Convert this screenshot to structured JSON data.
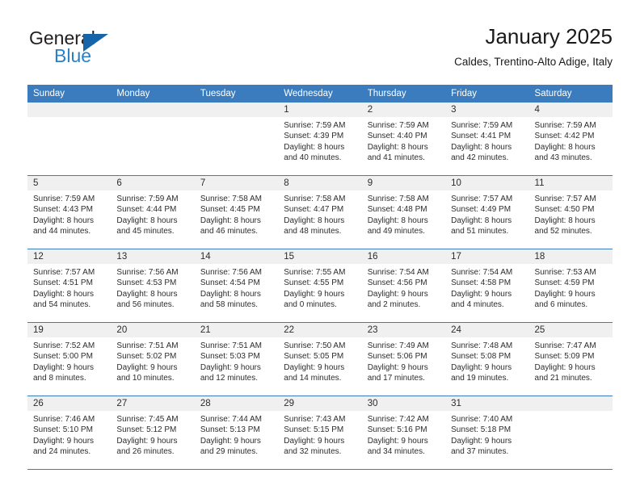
{
  "brand": {
    "name_top": "General",
    "name_bottom": "Blue",
    "color_dark": "#231f20",
    "color_blue": "#2a7fc9",
    "triangle_color": "#1565a8"
  },
  "header": {
    "title": "January 2025",
    "subtitle": "Caldes, Trentino-Alto Adige, Italy"
  },
  "theme": {
    "header_bg": "#3a7cbe",
    "header_text": "#ffffff",
    "daynum_band_bg": "#f0f0f0",
    "cell_bg": "#ffffff",
    "row_border": "#3a7cbe",
    "body_text": "#2c2c2c"
  },
  "weekday_headers": [
    "Sunday",
    "Monday",
    "Tuesday",
    "Wednesday",
    "Thursday",
    "Friday",
    "Saturday"
  ],
  "weeks": [
    [
      {
        "day": "",
        "empty": true,
        "lines": []
      },
      {
        "day": "",
        "empty": true,
        "lines": []
      },
      {
        "day": "",
        "empty": true,
        "lines": []
      },
      {
        "day": "1",
        "empty": false,
        "lines": [
          "Sunrise: 7:59 AM",
          "Sunset: 4:39 PM",
          "Daylight: 8 hours",
          "and 40 minutes."
        ]
      },
      {
        "day": "2",
        "empty": false,
        "lines": [
          "Sunrise: 7:59 AM",
          "Sunset: 4:40 PM",
          "Daylight: 8 hours",
          "and 41 minutes."
        ]
      },
      {
        "day": "3",
        "empty": false,
        "lines": [
          "Sunrise: 7:59 AM",
          "Sunset: 4:41 PM",
          "Daylight: 8 hours",
          "and 42 minutes."
        ]
      },
      {
        "day": "4",
        "empty": false,
        "lines": [
          "Sunrise: 7:59 AM",
          "Sunset: 4:42 PM",
          "Daylight: 8 hours",
          "and 43 minutes."
        ]
      }
    ],
    [
      {
        "day": "5",
        "empty": false,
        "lines": [
          "Sunrise: 7:59 AM",
          "Sunset: 4:43 PM",
          "Daylight: 8 hours",
          "and 44 minutes."
        ]
      },
      {
        "day": "6",
        "empty": false,
        "lines": [
          "Sunrise: 7:59 AM",
          "Sunset: 4:44 PM",
          "Daylight: 8 hours",
          "and 45 minutes."
        ]
      },
      {
        "day": "7",
        "empty": false,
        "lines": [
          "Sunrise: 7:58 AM",
          "Sunset: 4:45 PM",
          "Daylight: 8 hours",
          "and 46 minutes."
        ]
      },
      {
        "day": "8",
        "empty": false,
        "lines": [
          "Sunrise: 7:58 AM",
          "Sunset: 4:47 PM",
          "Daylight: 8 hours",
          "and 48 minutes."
        ]
      },
      {
        "day": "9",
        "empty": false,
        "lines": [
          "Sunrise: 7:58 AM",
          "Sunset: 4:48 PM",
          "Daylight: 8 hours",
          "and 49 minutes."
        ]
      },
      {
        "day": "10",
        "empty": false,
        "lines": [
          "Sunrise: 7:57 AM",
          "Sunset: 4:49 PM",
          "Daylight: 8 hours",
          "and 51 minutes."
        ]
      },
      {
        "day": "11",
        "empty": false,
        "lines": [
          "Sunrise: 7:57 AM",
          "Sunset: 4:50 PM",
          "Daylight: 8 hours",
          "and 52 minutes."
        ]
      }
    ],
    [
      {
        "day": "12",
        "empty": false,
        "lines": [
          "Sunrise: 7:57 AM",
          "Sunset: 4:51 PM",
          "Daylight: 8 hours",
          "and 54 minutes."
        ]
      },
      {
        "day": "13",
        "empty": false,
        "lines": [
          "Sunrise: 7:56 AM",
          "Sunset: 4:53 PM",
          "Daylight: 8 hours",
          "and 56 minutes."
        ]
      },
      {
        "day": "14",
        "empty": false,
        "lines": [
          "Sunrise: 7:56 AM",
          "Sunset: 4:54 PM",
          "Daylight: 8 hours",
          "and 58 minutes."
        ]
      },
      {
        "day": "15",
        "empty": false,
        "lines": [
          "Sunrise: 7:55 AM",
          "Sunset: 4:55 PM",
          "Daylight: 9 hours",
          "and 0 minutes."
        ]
      },
      {
        "day": "16",
        "empty": false,
        "lines": [
          "Sunrise: 7:54 AM",
          "Sunset: 4:56 PM",
          "Daylight: 9 hours",
          "and 2 minutes."
        ]
      },
      {
        "day": "17",
        "empty": false,
        "lines": [
          "Sunrise: 7:54 AM",
          "Sunset: 4:58 PM",
          "Daylight: 9 hours",
          "and 4 minutes."
        ]
      },
      {
        "day": "18",
        "empty": false,
        "lines": [
          "Sunrise: 7:53 AM",
          "Sunset: 4:59 PM",
          "Daylight: 9 hours",
          "and 6 minutes."
        ]
      }
    ],
    [
      {
        "day": "19",
        "empty": false,
        "lines": [
          "Sunrise: 7:52 AM",
          "Sunset: 5:00 PM",
          "Daylight: 9 hours",
          "and 8 minutes."
        ]
      },
      {
        "day": "20",
        "empty": false,
        "lines": [
          "Sunrise: 7:51 AM",
          "Sunset: 5:02 PM",
          "Daylight: 9 hours",
          "and 10 minutes."
        ]
      },
      {
        "day": "21",
        "empty": false,
        "lines": [
          "Sunrise: 7:51 AM",
          "Sunset: 5:03 PM",
          "Daylight: 9 hours",
          "and 12 minutes."
        ]
      },
      {
        "day": "22",
        "empty": false,
        "lines": [
          "Sunrise: 7:50 AM",
          "Sunset: 5:05 PM",
          "Daylight: 9 hours",
          "and 14 minutes."
        ]
      },
      {
        "day": "23",
        "empty": false,
        "lines": [
          "Sunrise: 7:49 AM",
          "Sunset: 5:06 PM",
          "Daylight: 9 hours",
          "and 17 minutes."
        ]
      },
      {
        "day": "24",
        "empty": false,
        "lines": [
          "Sunrise: 7:48 AM",
          "Sunset: 5:08 PM",
          "Daylight: 9 hours",
          "and 19 minutes."
        ]
      },
      {
        "day": "25",
        "empty": false,
        "lines": [
          "Sunrise: 7:47 AM",
          "Sunset: 5:09 PM",
          "Daylight: 9 hours",
          "and 21 minutes."
        ]
      }
    ],
    [
      {
        "day": "26",
        "empty": false,
        "lines": [
          "Sunrise: 7:46 AM",
          "Sunset: 5:10 PM",
          "Daylight: 9 hours",
          "and 24 minutes."
        ]
      },
      {
        "day": "27",
        "empty": false,
        "lines": [
          "Sunrise: 7:45 AM",
          "Sunset: 5:12 PM",
          "Daylight: 9 hours",
          "and 26 minutes."
        ]
      },
      {
        "day": "28",
        "empty": false,
        "lines": [
          "Sunrise: 7:44 AM",
          "Sunset: 5:13 PM",
          "Daylight: 9 hours",
          "and 29 minutes."
        ]
      },
      {
        "day": "29",
        "empty": false,
        "lines": [
          "Sunrise: 7:43 AM",
          "Sunset: 5:15 PM",
          "Daylight: 9 hours",
          "and 32 minutes."
        ]
      },
      {
        "day": "30",
        "empty": false,
        "lines": [
          "Sunrise: 7:42 AM",
          "Sunset: 5:16 PM",
          "Daylight: 9 hours",
          "and 34 minutes."
        ]
      },
      {
        "day": "31",
        "empty": false,
        "lines": [
          "Sunrise: 7:40 AM",
          "Sunset: 5:18 PM",
          "Daylight: 9 hours",
          "and 37 minutes."
        ]
      },
      {
        "day": "",
        "empty": true,
        "lines": []
      }
    ]
  ]
}
